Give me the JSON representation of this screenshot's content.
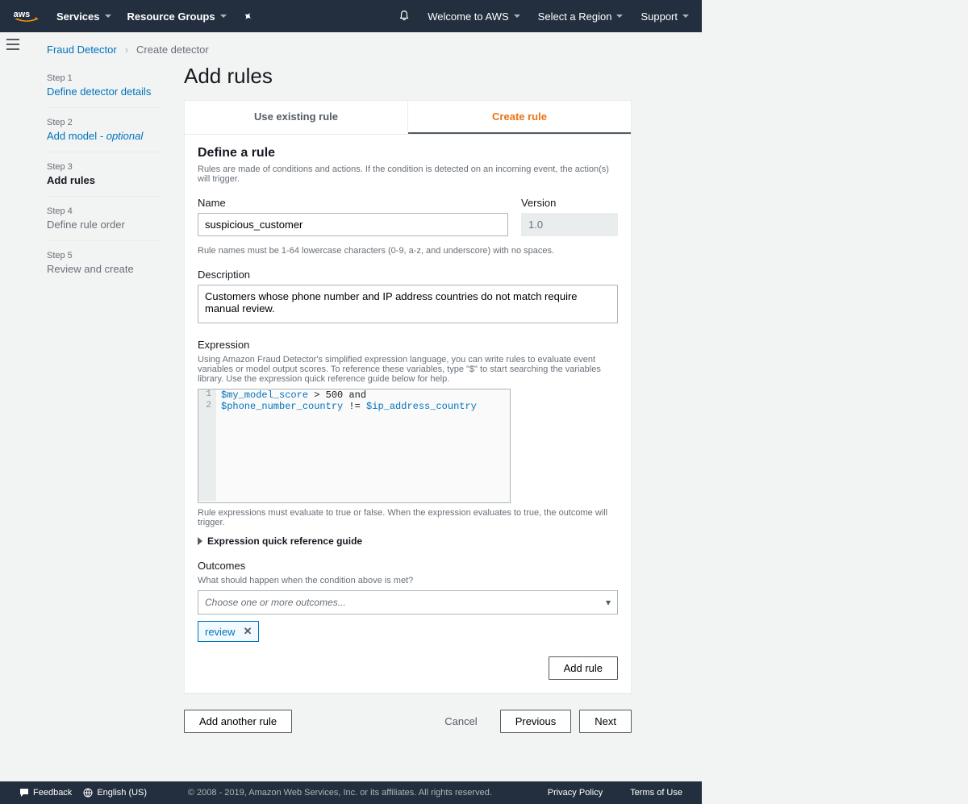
{
  "header": {
    "nav_services": "Services",
    "nav_resource_groups": "Resource Groups",
    "welcome": "Welcome to AWS",
    "region": "Select a Region",
    "support": "Support"
  },
  "breadcrumb": {
    "root": "Fraud Detector",
    "current": "Create detector"
  },
  "sidebar": {
    "steps": [
      {
        "label": "Step 1",
        "title": "Define detector details",
        "state": "link"
      },
      {
        "label": "Step 2",
        "title_prefix": "Add model",
        "title_suffix": " - optional",
        "state": "link"
      },
      {
        "label": "Step 3",
        "title": "Add rules",
        "state": "current"
      },
      {
        "label": "Step 4",
        "title": "Define rule order",
        "state": "future"
      },
      {
        "label": "Step 5",
        "title": "Review and create",
        "state": "future"
      }
    ]
  },
  "page": {
    "title": "Add rules",
    "tabs": {
      "existing": "Use existing rule",
      "create": "Create rule"
    },
    "define": {
      "heading": "Define a rule",
      "desc": "Rules are made of conditions and actions. If the condition is detected on an incoming event, the action(s) will trigger.",
      "name_label": "Name",
      "name_value": "suspicious_customer",
      "name_hint": "Rule names must be 1-64 lowercase characters (0-9, a-z, and underscore) with no spaces.",
      "version_label": "Version",
      "version_value": "1.0",
      "desc_label": "Description",
      "desc_value": "Customers whose phone number and IP address countries do not match require manual review.",
      "expr_label": "Expression",
      "expr_help": "Using Amazon Fraud Detector's simplified expression language, you can write rules to evaluate event variables or model output scores. To reference these variables, type \"$\" to start searching the variables library. Use the expression quick reference guide below for help.",
      "expr_lines": [
        {
          "n": "1",
          "tokens": [
            "$my_model_score",
            " > ",
            "500",
            " and"
          ]
        },
        {
          "n": "2",
          "tokens": [
            "$phone_number_country",
            " != ",
            "$ip_address_country"
          ]
        }
      ],
      "expr_hint": "Rule expressions must evaluate to true or false. When the expression evaluates to true, the outcome will trigger.",
      "expander": "Expression quick reference guide",
      "outcomes_label": "Outcomes",
      "outcomes_help": "What should happen when the condition above is met?",
      "outcomes_placeholder": "Choose one or more outcomes...",
      "chip_review": "review",
      "add_rule_btn": "Add rule"
    },
    "footer": {
      "add_another": "Add another rule",
      "cancel": "Cancel",
      "previous": "Previous",
      "next": "Next"
    }
  },
  "footer": {
    "feedback": "Feedback",
    "language": "English (US)",
    "legal": "© 2008 - 2019, Amazon Web Services, Inc. or its affiliates. All rights reserved.",
    "privacy": "Privacy Policy",
    "terms": "Terms of Use"
  }
}
